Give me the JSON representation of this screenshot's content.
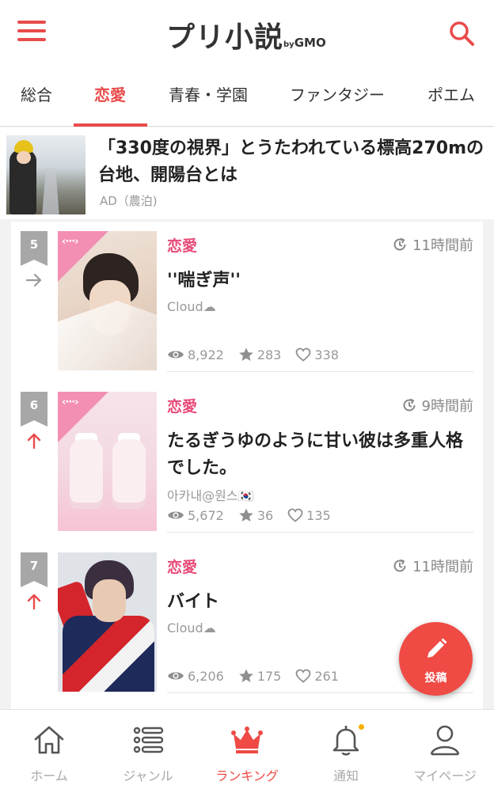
{
  "app": {
    "logo": "プリ小説",
    "logo_by": "by",
    "logo_gmo": "GMO",
    "accent_color": "#e94b4b",
    "genre_color": "#e84b78"
  },
  "header": {
    "menu_icon": "hamburger-menu-icon",
    "search_icon": "search-icon"
  },
  "tabs": [
    {
      "label": "総合",
      "active": false
    },
    {
      "label": "恋愛",
      "active": true
    },
    {
      "label": "青春・学園",
      "active": false
    },
    {
      "label": "ファンタジー",
      "active": false
    },
    {
      "label": "ポエム",
      "active": false
    }
  ],
  "ad": {
    "title": "「330度の視界」とうたわれている標高270mの台地、開陽台とは",
    "label": "AD（農泊)"
  },
  "ranking": [
    {
      "rank": "5",
      "trend": "same",
      "genre": "恋愛",
      "time": "11時間前",
      "title": "''喘ぎ声''",
      "author": "Cloud☁",
      "views": "8,922",
      "stars": "283",
      "likes": "338"
    },
    {
      "rank": "6",
      "trend": "up",
      "genre": "恋愛",
      "time": "9時間前",
      "title": "たるぎうゆのように甘い彼は多重人格でした。",
      "author": "아카내@원스🇰🇷",
      "views": "5,672",
      "stars": "36",
      "likes": "135"
    },
    {
      "rank": "7",
      "trend": "up",
      "genre": "恋愛",
      "time": "11時間前",
      "title": "バイト",
      "author": "Cloud☁",
      "views": "6,206",
      "stars": "175",
      "likes": "261"
    }
  ],
  "fab": {
    "label": "投稿",
    "icon": "pencil-icon"
  },
  "bottom_nav": [
    {
      "label": "ホーム",
      "icon": "home-icon",
      "active": false
    },
    {
      "label": "ジャンル",
      "icon": "list-icon",
      "active": false
    },
    {
      "label": "ランキング",
      "icon": "crown-icon",
      "active": true
    },
    {
      "label": "通知",
      "icon": "bell-icon",
      "active": false
    },
    {
      "label": "マイページ",
      "icon": "user-icon",
      "active": false
    }
  ]
}
